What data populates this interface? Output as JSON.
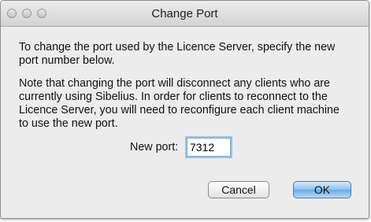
{
  "window": {
    "title": "Change Port"
  },
  "dialog": {
    "instruction": "To change the port used by the Licence Server, specify the new port number below.",
    "warning": "Note that changing the port will disconnect any clients who are currently using Sibelius. In order for clients to reconnect to the Licence Server, you will need to reconfigure each client machine to use the new port.",
    "port_label": "New port:",
    "port_value": "7312"
  },
  "buttons": {
    "cancel_label": "Cancel",
    "ok_label": "OK"
  },
  "colors": {
    "default_button": "#8dc0ef",
    "focus_ring": "#9cc1ec"
  }
}
